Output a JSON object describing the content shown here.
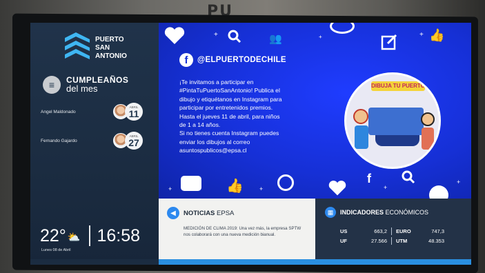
{
  "wall": {
    "sign": "PU"
  },
  "logo": {
    "line1": "PUERTO",
    "line2": "SAN",
    "line3": "ANTONIO"
  },
  "birthdays": {
    "title_line1": "CUMPLEAÑOS",
    "title_line2": "del mes",
    "people": [
      {
        "name": "Angel Maldonado",
        "month": "ABRIL",
        "day": "11"
      },
      {
        "name": "Fernando Gajardo",
        "month": "ABRIL",
        "day": "27"
      }
    ]
  },
  "weather": {
    "temperature": "22°",
    "icon": "partly-cloudy-icon"
  },
  "clock": {
    "time": "16:58",
    "date": "Lunes 08 de Abril"
  },
  "promo": {
    "handle": "@ELPUERTODECHILE",
    "lines": [
      "¡Te invitamos a participar en",
      "#PintaTuPuertoSanAntonio! Publica el",
      "dibujo y etiquétanos en Instagram para",
      "participar por entretenidos premios.",
      "Hasta el jueves 11 de abril, para niños",
      "de 1 a 14 años.",
      "Si no tienes cuenta Instagram puedes",
      "enviar los dibujos al correo",
      "asuntospublicos@epsa.cl"
    ],
    "image_banner": "DIBUJA TU PUERTO"
  },
  "news": {
    "title_bold": "NOTICIAS",
    "title_rest": " EPSA",
    "body": "MEDICIÓN DE CLIMA 2019: Una vez más, la empresa SPTW nos colaborará con una nueva medición bianual."
  },
  "indicators": {
    "title_bold": "INDICADORES",
    "title_rest": " ECONÓMICOS",
    "rows": [
      {
        "k1": "US",
        "v1": "663,2",
        "k2": "EURO",
        "v2": "747,3"
      },
      {
        "k1": "UF",
        "v1": "27.566",
        "k2": "UTM",
        "v2": "48.353"
      }
    ]
  },
  "colors": {
    "promo_blue": "#1630d6",
    "sidebar": "#1b2c41",
    "accent": "#2d89ef"
  }
}
